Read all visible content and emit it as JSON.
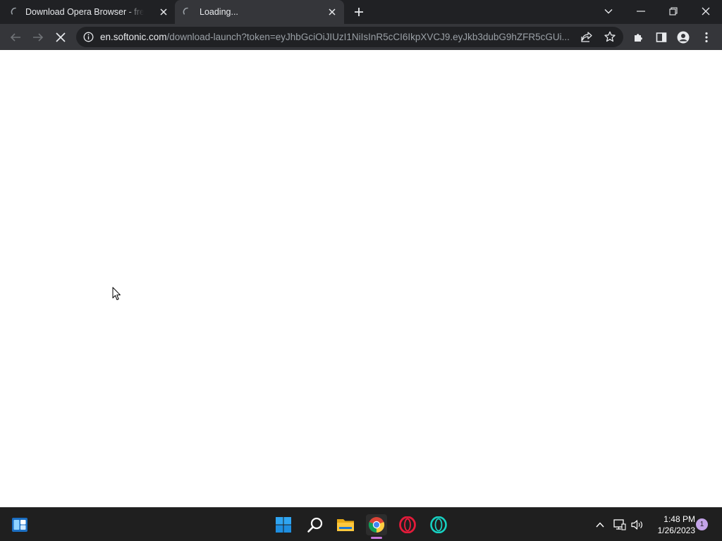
{
  "browser": {
    "tabs": [
      {
        "title": "Download Opera Browser - free - ",
        "state": "loading",
        "active": false
      },
      {
        "title": "Loading...",
        "state": "loading",
        "active": true
      }
    ],
    "toolbar": {
      "url_host": "en.softonic.com",
      "url_path": "/download-launch?token=eyJhbGciOiJIUzI1NiIsInR5cCI6IkpXVCJ9.eyJkb3dubG9hZFR5cGUi..."
    },
    "colors": {
      "tab_strip": "#202124",
      "toolbar": "#35363a",
      "omnibox": "#202124",
      "text": "#e8eaed"
    }
  },
  "page": {
    "content": ""
  },
  "taskbar": {
    "apps": [
      {
        "name": "widgets",
        "icon": "widgets-icon"
      },
      {
        "name": "start",
        "icon": "windows-start-icon"
      },
      {
        "name": "search",
        "icon": "search-icon"
      },
      {
        "name": "file-explorer",
        "icon": "folder-icon"
      },
      {
        "name": "chrome",
        "icon": "chrome-icon",
        "active": true
      },
      {
        "name": "opera",
        "icon": "opera-icon"
      },
      {
        "name": "opera-gx",
        "icon": "opera-gx-icon"
      }
    ],
    "tray": {
      "time": "1:48 PM",
      "date": "1/26/2023",
      "notification_count": "1"
    },
    "colors": {
      "background": "#1f1f1f",
      "active_indicator": "#c678dd"
    }
  }
}
